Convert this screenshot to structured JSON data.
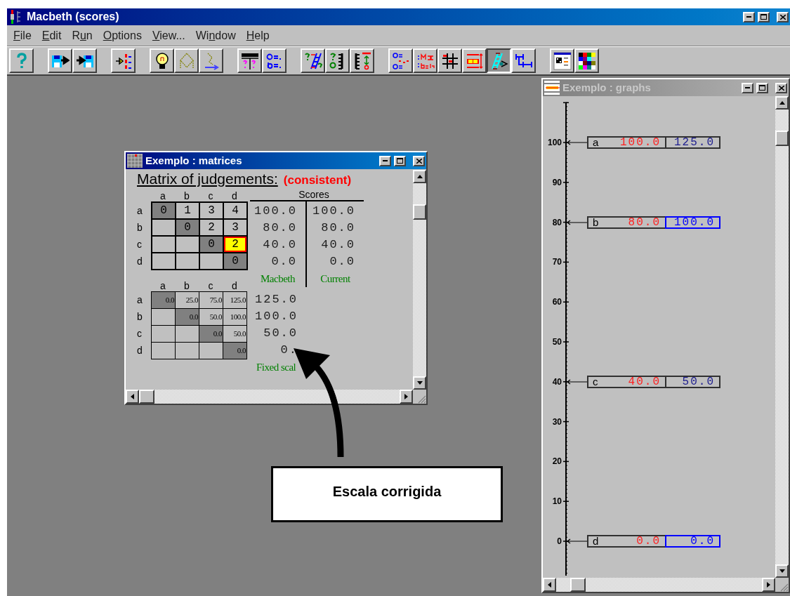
{
  "main_window": {
    "title": "Macbeth (scores)",
    "active": true
  },
  "menu": [
    {
      "key": "F",
      "post": "ile"
    },
    {
      "key": "E",
      "post": "dit"
    },
    {
      "pre": "R",
      "key": "u",
      "post": "n"
    },
    {
      "key": "O",
      "post": "ptions"
    },
    {
      "key": "V",
      "post": "iew..."
    },
    {
      "pre": "Wi",
      "key": "n",
      "post": "dow"
    },
    {
      "key": "H",
      "post": "elp"
    }
  ],
  "toolbar": [
    [
      {
        "kind": "help",
        "pressed": false
      }
    ],
    [
      {
        "kind": "save",
        "pressed": false
      },
      {
        "kind": "load",
        "pressed": false
      }
    ],
    [
      {
        "kind": "order",
        "pressed": false
      }
    ],
    [
      {
        "kind": "idea",
        "pressed": false
      },
      {
        "kind": "tree",
        "pressed": false
      },
      {
        "kind": "tree-arrow",
        "pressed": false
      }
    ],
    [
      {
        "kind": "scores",
        "pressed": false
      },
      {
        "kind": "equations",
        "pressed": false
      }
    ],
    [
      {
        "kind": "ladder",
        "pressed": false
      },
      {
        "kind": "scale",
        "pressed": false
      },
      {
        "kind": "scale-max",
        "pressed": false
      }
    ],
    [
      {
        "kind": "dots",
        "pressed": false
      },
      {
        "kind": "dotted",
        "pressed": false
      },
      {
        "kind": "grid",
        "pressed": false
      },
      {
        "kind": "bar",
        "pressed": false
      },
      {
        "kind": "ladder-eye",
        "pressed": true
      },
      {
        "kind": "intervals",
        "pressed": false
      }
    ],
    [
      {
        "kind": "layout",
        "pressed": false
      },
      {
        "kind": "palette",
        "pressed": false
      }
    ]
  ],
  "matrices_window": {
    "title": "Exemplo : matrices",
    "active": true,
    "heading": "Matrix of judgements:",
    "status": "(consistent)",
    "judgements": {
      "columns": [
        "a",
        "b",
        "c",
        "d"
      ],
      "rows": [
        {
          "label": "a",
          "cells": [
            {
              "kind": "diagonal",
              "value": "0",
              "selected": false
            },
            {
              "kind": "entry",
              "value": "1",
              "selected": false
            },
            {
              "kind": "entry",
              "value": "3",
              "selected": false
            },
            {
              "kind": "entry",
              "value": "4",
              "selected": false
            }
          ]
        },
        {
          "label": "b",
          "cells": [
            {
              "kind": "blank",
              "selected": false
            },
            {
              "kind": "diagonal",
              "value": "0",
              "selected": false
            },
            {
              "kind": "entry",
              "value": "2",
              "selected": false
            },
            {
              "kind": "entry",
              "value": "3",
              "selected": false
            }
          ]
        },
        {
          "label": "c",
          "cells": [
            {
              "kind": "blank",
              "selected": false
            },
            {
              "kind": "blank",
              "selected": false
            },
            {
              "kind": "diagonal",
              "value": "0",
              "selected": false
            },
            {
              "kind": "entry",
              "value": "2",
              "selected": true
            }
          ]
        },
        {
          "label": "d",
          "cells": [
            {
              "kind": "blank",
              "selected": false
            },
            {
              "kind": "blank",
              "selected": false
            },
            {
              "kind": "blank",
              "selected": false
            },
            {
              "kind": "diagonal",
              "value": "0",
              "selected": false
            }
          ]
        }
      ]
    },
    "scores": {
      "title": "Scores",
      "columns": [
        {
          "label": "Macbeth",
          "values": [
            "100.0",
            "80.0",
            "40.0",
            "0.0"
          ]
        },
        {
          "label": "Current",
          "values": [
            "100.0",
            "80.0",
            "40.0",
            "0.0"
          ]
        }
      ]
    },
    "differences": {
      "columns": [
        "a",
        "b",
        "c",
        "d"
      ],
      "rows": [
        {
          "label": "a",
          "cells": [
            {
              "kind": "diagonal",
              "value": "0.0"
            },
            {
              "kind": "entry",
              "value": "25.0"
            },
            {
              "kind": "entry",
              "value": "75.0"
            },
            {
              "kind": "entry",
              "value": "125.0"
            }
          ]
        },
        {
          "label": "b",
          "cells": [
            {
              "kind": "blank"
            },
            {
              "kind": "diagonal",
              "value": "0.0"
            },
            {
              "kind": "entry",
              "value": "50.0"
            },
            {
              "kind": "entry",
              "value": "100.0"
            }
          ]
        },
        {
          "label": "c",
          "cells": [
            {
              "kind": "blank"
            },
            {
              "kind": "blank"
            },
            {
              "kind": "diagonal",
              "value": "0.0"
            },
            {
              "kind": "entry",
              "value": "50.0"
            }
          ]
        },
        {
          "label": "d",
          "cells": [
            {
              "kind": "blank"
            },
            {
              "kind": "blank"
            },
            {
              "kind": "blank"
            },
            {
              "kind": "diagonal",
              "value": "0.0"
            }
          ]
        }
      ]
    },
    "fixed_scale": {
      "label": "Fixed scal",
      "values": [
        "125.0",
        "100.0",
        "50.0",
        "0."
      ]
    }
  },
  "graphs_window": {
    "title": "Exemplo : graphs",
    "active": false,
    "ticks": [
      {
        "label": "100",
        "option": {
          "label": "a",
          "macbeth": "100.0",
          "current": "125.0",
          "outlined": false
        }
      },
      {
        "label": "90"
      },
      {
        "label": "80",
        "option": {
          "label": "b",
          "macbeth": "80.0",
          "current": "100.0",
          "outlined": true
        }
      },
      {
        "label": "70"
      },
      {
        "label": "60"
      },
      {
        "label": "50"
      },
      {
        "label": "40",
        "option": {
          "label": "c",
          "macbeth": "40.0",
          "current": "50.0",
          "outlined": false
        }
      },
      {
        "label": "30"
      },
      {
        "label": "20"
      },
      {
        "label": "10"
      },
      {
        "label": "0",
        "option": {
          "label": "d",
          "macbeth": "0.0",
          "current": "0.0",
          "outlined": true
        }
      }
    ]
  },
  "callout": {
    "text": "Escala corrigida"
  }
}
